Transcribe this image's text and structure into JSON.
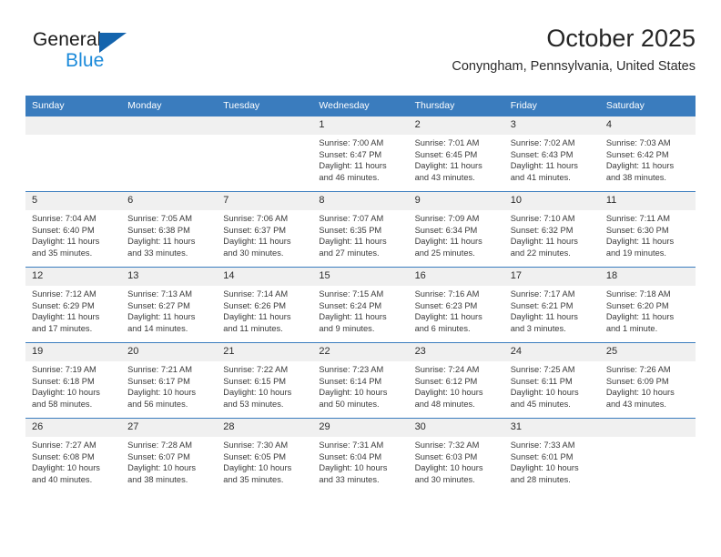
{
  "brand": {
    "name_part1": "General",
    "name_part2": "Blue",
    "logo_icon": "triangle-logo-icon"
  },
  "header": {
    "title": "October 2025",
    "location": "Conyngham, Pennsylvania, United States"
  },
  "theme": {
    "header_blue": "#3a7cbe",
    "brand_dark_blue": "#1464ad",
    "brand_light_blue": "#1b8ada",
    "daynum_bg": "#f0f0f0",
    "text": "#3a3a3a"
  },
  "weekdays": [
    "Sunday",
    "Monday",
    "Tuesday",
    "Wednesday",
    "Thursday",
    "Friday",
    "Saturday"
  ],
  "labels": {
    "sunrise_prefix": "Sunrise: ",
    "sunset_prefix": "Sunset: ",
    "daylight_prefix": "Daylight: "
  },
  "weeks": [
    [
      {
        "day": "",
        "sunrise": "",
        "sunset": "",
        "daylight_line1": "",
        "daylight_line2": "",
        "empty": true
      },
      {
        "day": "",
        "sunrise": "",
        "sunset": "",
        "daylight_line1": "",
        "daylight_line2": "",
        "empty": true
      },
      {
        "day": "",
        "sunrise": "",
        "sunset": "",
        "daylight_line1": "",
        "daylight_line2": "",
        "empty": true
      },
      {
        "day": "1",
        "sunrise": "Sunrise: 7:00 AM",
        "sunset": "Sunset: 6:47 PM",
        "daylight_line1": "Daylight: 11 hours",
        "daylight_line2": "and 46 minutes.",
        "empty": false
      },
      {
        "day": "2",
        "sunrise": "Sunrise: 7:01 AM",
        "sunset": "Sunset: 6:45 PM",
        "daylight_line1": "Daylight: 11 hours",
        "daylight_line2": "and 43 minutes.",
        "empty": false
      },
      {
        "day": "3",
        "sunrise": "Sunrise: 7:02 AM",
        "sunset": "Sunset: 6:43 PM",
        "daylight_line1": "Daylight: 11 hours",
        "daylight_line2": "and 41 minutes.",
        "empty": false
      },
      {
        "day": "4",
        "sunrise": "Sunrise: 7:03 AM",
        "sunset": "Sunset: 6:42 PM",
        "daylight_line1": "Daylight: 11 hours",
        "daylight_line2": "and 38 minutes.",
        "empty": false
      }
    ],
    [
      {
        "day": "5",
        "sunrise": "Sunrise: 7:04 AM",
        "sunset": "Sunset: 6:40 PM",
        "daylight_line1": "Daylight: 11 hours",
        "daylight_line2": "and 35 minutes.",
        "empty": false
      },
      {
        "day": "6",
        "sunrise": "Sunrise: 7:05 AM",
        "sunset": "Sunset: 6:38 PM",
        "daylight_line1": "Daylight: 11 hours",
        "daylight_line2": "and 33 minutes.",
        "empty": false
      },
      {
        "day": "7",
        "sunrise": "Sunrise: 7:06 AM",
        "sunset": "Sunset: 6:37 PM",
        "daylight_line1": "Daylight: 11 hours",
        "daylight_line2": "and 30 minutes.",
        "empty": false
      },
      {
        "day": "8",
        "sunrise": "Sunrise: 7:07 AM",
        "sunset": "Sunset: 6:35 PM",
        "daylight_line1": "Daylight: 11 hours",
        "daylight_line2": "and 27 minutes.",
        "empty": false
      },
      {
        "day": "9",
        "sunrise": "Sunrise: 7:09 AM",
        "sunset": "Sunset: 6:34 PM",
        "daylight_line1": "Daylight: 11 hours",
        "daylight_line2": "and 25 minutes.",
        "empty": false
      },
      {
        "day": "10",
        "sunrise": "Sunrise: 7:10 AM",
        "sunset": "Sunset: 6:32 PM",
        "daylight_line1": "Daylight: 11 hours",
        "daylight_line2": "and 22 minutes.",
        "empty": false
      },
      {
        "day": "11",
        "sunrise": "Sunrise: 7:11 AM",
        "sunset": "Sunset: 6:30 PM",
        "daylight_line1": "Daylight: 11 hours",
        "daylight_line2": "and 19 minutes.",
        "empty": false
      }
    ],
    [
      {
        "day": "12",
        "sunrise": "Sunrise: 7:12 AM",
        "sunset": "Sunset: 6:29 PM",
        "daylight_line1": "Daylight: 11 hours",
        "daylight_line2": "and 17 minutes.",
        "empty": false
      },
      {
        "day": "13",
        "sunrise": "Sunrise: 7:13 AM",
        "sunset": "Sunset: 6:27 PM",
        "daylight_line1": "Daylight: 11 hours",
        "daylight_line2": "and 14 minutes.",
        "empty": false
      },
      {
        "day": "14",
        "sunrise": "Sunrise: 7:14 AM",
        "sunset": "Sunset: 6:26 PM",
        "daylight_line1": "Daylight: 11 hours",
        "daylight_line2": "and 11 minutes.",
        "empty": false
      },
      {
        "day": "15",
        "sunrise": "Sunrise: 7:15 AM",
        "sunset": "Sunset: 6:24 PM",
        "daylight_line1": "Daylight: 11 hours",
        "daylight_line2": "and 9 minutes.",
        "empty": false
      },
      {
        "day": "16",
        "sunrise": "Sunrise: 7:16 AM",
        "sunset": "Sunset: 6:23 PM",
        "daylight_line1": "Daylight: 11 hours",
        "daylight_line2": "and 6 minutes.",
        "empty": false
      },
      {
        "day": "17",
        "sunrise": "Sunrise: 7:17 AM",
        "sunset": "Sunset: 6:21 PM",
        "daylight_line1": "Daylight: 11 hours",
        "daylight_line2": "and 3 minutes.",
        "empty": false
      },
      {
        "day": "18",
        "sunrise": "Sunrise: 7:18 AM",
        "sunset": "Sunset: 6:20 PM",
        "daylight_line1": "Daylight: 11 hours",
        "daylight_line2": "and 1 minute.",
        "empty": false
      }
    ],
    [
      {
        "day": "19",
        "sunrise": "Sunrise: 7:19 AM",
        "sunset": "Sunset: 6:18 PM",
        "daylight_line1": "Daylight: 10 hours",
        "daylight_line2": "and 58 minutes.",
        "empty": false
      },
      {
        "day": "20",
        "sunrise": "Sunrise: 7:21 AM",
        "sunset": "Sunset: 6:17 PM",
        "daylight_line1": "Daylight: 10 hours",
        "daylight_line2": "and 56 minutes.",
        "empty": false
      },
      {
        "day": "21",
        "sunrise": "Sunrise: 7:22 AM",
        "sunset": "Sunset: 6:15 PM",
        "daylight_line1": "Daylight: 10 hours",
        "daylight_line2": "and 53 minutes.",
        "empty": false
      },
      {
        "day": "22",
        "sunrise": "Sunrise: 7:23 AM",
        "sunset": "Sunset: 6:14 PM",
        "daylight_line1": "Daylight: 10 hours",
        "daylight_line2": "and 50 minutes.",
        "empty": false
      },
      {
        "day": "23",
        "sunrise": "Sunrise: 7:24 AM",
        "sunset": "Sunset: 6:12 PM",
        "daylight_line1": "Daylight: 10 hours",
        "daylight_line2": "and 48 minutes.",
        "empty": false
      },
      {
        "day": "24",
        "sunrise": "Sunrise: 7:25 AM",
        "sunset": "Sunset: 6:11 PM",
        "daylight_line1": "Daylight: 10 hours",
        "daylight_line2": "and 45 minutes.",
        "empty": false
      },
      {
        "day": "25",
        "sunrise": "Sunrise: 7:26 AM",
        "sunset": "Sunset: 6:09 PM",
        "daylight_line1": "Daylight: 10 hours",
        "daylight_line2": "and 43 minutes.",
        "empty": false
      }
    ],
    [
      {
        "day": "26",
        "sunrise": "Sunrise: 7:27 AM",
        "sunset": "Sunset: 6:08 PM",
        "daylight_line1": "Daylight: 10 hours",
        "daylight_line2": "and 40 minutes.",
        "empty": false
      },
      {
        "day": "27",
        "sunrise": "Sunrise: 7:28 AM",
        "sunset": "Sunset: 6:07 PM",
        "daylight_line1": "Daylight: 10 hours",
        "daylight_line2": "and 38 minutes.",
        "empty": false
      },
      {
        "day": "28",
        "sunrise": "Sunrise: 7:30 AM",
        "sunset": "Sunset: 6:05 PM",
        "daylight_line1": "Daylight: 10 hours",
        "daylight_line2": "and 35 minutes.",
        "empty": false
      },
      {
        "day": "29",
        "sunrise": "Sunrise: 7:31 AM",
        "sunset": "Sunset: 6:04 PM",
        "daylight_line1": "Daylight: 10 hours",
        "daylight_line2": "and 33 minutes.",
        "empty": false
      },
      {
        "day": "30",
        "sunrise": "Sunrise: 7:32 AM",
        "sunset": "Sunset: 6:03 PM",
        "daylight_line1": "Daylight: 10 hours",
        "daylight_line2": "and 30 minutes.",
        "empty": false
      },
      {
        "day": "31",
        "sunrise": "Sunrise: 7:33 AM",
        "sunset": "Sunset: 6:01 PM",
        "daylight_line1": "Daylight: 10 hours",
        "daylight_line2": "and 28 minutes.",
        "empty": false
      },
      {
        "day": "",
        "sunrise": "",
        "sunset": "",
        "daylight_line1": "",
        "daylight_line2": "",
        "empty": true
      }
    ]
  ]
}
